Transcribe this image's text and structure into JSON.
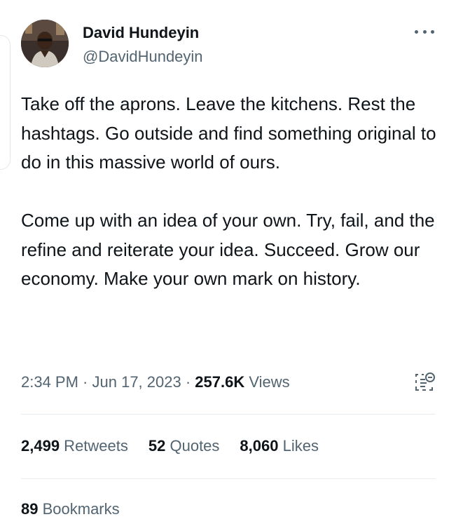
{
  "author": {
    "name": "David Hundeyin",
    "handle": "@DavidHundeyin"
  },
  "tweet": {
    "paragraphs": [
      "Take off the aprons. Leave the kitchens. Rest the hashtags. Go outside and find something original to do in this massive world of ours.",
      "Come up with an idea of your own. Try, fail, and the refine and reiterate your idea. Succeed. Grow our economy. Make your own mark on history."
    ]
  },
  "meta": {
    "time": "2:34 PM",
    "separator": " · ",
    "date": "Jun 17, 2023",
    "views_count": "257.6K",
    "views_label": " Views"
  },
  "stats": {
    "retweets": {
      "count": "2,499",
      "label": " Retweets"
    },
    "quotes": {
      "count": "52",
      "label": " Quotes"
    },
    "likes": {
      "count": "8,060",
      "label": " Likes"
    },
    "bookmarks": {
      "count": "89",
      "label": " Bookmarks"
    }
  },
  "icons": {
    "more": "more-horizontal-icon",
    "analytics": "analytics-icon"
  },
  "colors": {
    "text_primary": "#0f1419",
    "text_secondary": "#536471",
    "divider": "#e6ecf0"
  }
}
